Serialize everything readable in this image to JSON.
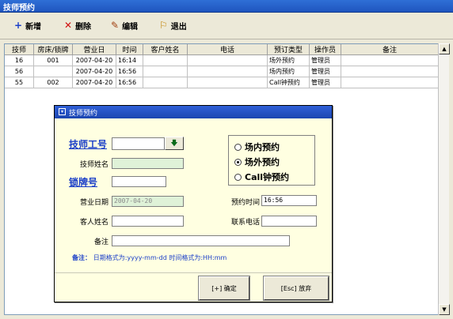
{
  "window": {
    "title": "技师预约"
  },
  "toolbar": [
    {
      "icon": "plus-icon",
      "glyph": "+",
      "color": "#1a3ec8",
      "label": "新增"
    },
    {
      "icon": "delete-x-icon",
      "glyph": "✕",
      "color": "#d01010",
      "label": "删除"
    },
    {
      "icon": "edit-icon",
      "glyph": "✎",
      "color": "#a04010",
      "label": "编辑"
    },
    {
      "icon": "exit-icon",
      "glyph": "⚐",
      "color": "#c08000",
      "label": "退出"
    }
  ],
  "grid": {
    "columns": [
      "技师",
      "房床/锁牌",
      "营业日",
      "时间",
      "客户姓名",
      "电话",
      "预订类型",
      "操作员",
      "备注"
    ],
    "rows": [
      [
        "16",
        "001",
        "2007-04-20",
        "16:14",
        "",
        "",
        "场外预约",
        "管理员",
        ""
      ],
      [
        "56",
        "",
        "2007-04-20",
        "16:56",
        "",
        "",
        "场内预约",
        "管理员",
        ""
      ],
      [
        "55",
        "002",
        "2007-04-20",
        "16:56",
        "",
        "",
        "Call钟预约",
        "管理员",
        ""
      ]
    ]
  },
  "dialog": {
    "title": "技师预约",
    "tech_no_label": "技师工号",
    "tech_no_value": "",
    "tech_name_label": "技师姓名",
    "tech_name_value": "",
    "lock_no_label": "锁牌号",
    "lock_no_value": "",
    "biz_date_label": "营业日期",
    "biz_date_value": "2007-04-20",
    "appt_time_label": "预约时间",
    "appt_time_value": "16:56",
    "customer_label": "客人姓名",
    "customer_value": "",
    "phone_label": "联系电话",
    "phone_value": "",
    "remark_label": "备注",
    "remark_value": "",
    "radio_options": [
      {
        "label": "场内预约",
        "selected": false
      },
      {
        "label": "场外预约",
        "selected": true
      },
      {
        "label": "Call钟预约",
        "selected": false
      }
    ],
    "note_label": "备注：",
    "note_text": "日期格式为:yyyy-mm-dd   时间格式为:HH:mm",
    "ok_label": "[+] 确定",
    "cancel_label": "[Esc] 放弃"
  },
  "colors": {
    "accent": "#1a3ec8",
    "dialog_bg": "#ffffe1",
    "readonly_bg": "#dff2d8"
  }
}
